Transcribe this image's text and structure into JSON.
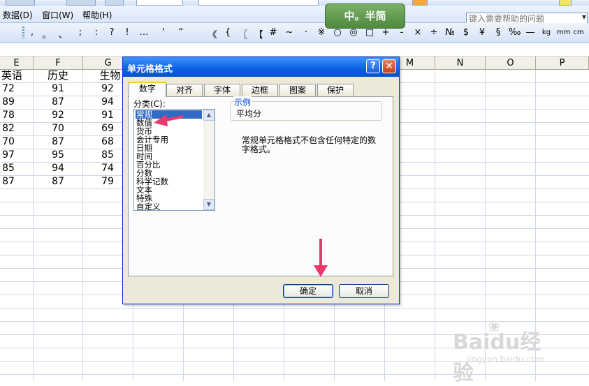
{
  "menu": {
    "items": [
      "数据(D)",
      "窗口(W)",
      "帮助(H)"
    ],
    "help_search_placeholder": "键入需要帮助的问题"
  },
  "badge": {
    "text": "中。半简"
  },
  "symbols": [
    ",",
    "。",
    "、",
    ";",
    ":",
    "?",
    "!",
    "…",
    "‘",
    "“",
    "《",
    "{",
    "〖",
    "【",
    "#",
    "~",
    "·",
    "※",
    "○",
    "◎",
    "□",
    "+",
    "-",
    "×",
    "÷",
    "№",
    "$",
    "¥",
    "§",
    "‰",
    "—",
    "kg",
    "mm",
    "cm"
  ],
  "spreadsheet": {
    "columns": [
      "E",
      "F",
      "G",
      "M",
      "N",
      "O",
      "P"
    ],
    "headers": [
      "英语",
      "历史",
      "生物"
    ],
    "rows": [
      [
        "72",
        "91",
        "92"
      ],
      [
        "89",
        "87",
        "94"
      ],
      [
        "78",
        "92",
        "91"
      ],
      [
        "82",
        "70",
        "69"
      ],
      [
        "70",
        "87",
        "68"
      ],
      [
        "97",
        "95",
        "85"
      ],
      [
        "85",
        "94",
        "74"
      ],
      [
        "87",
        "87",
        "79"
      ]
    ]
  },
  "dialog": {
    "title": "单元格格式",
    "help_button": "?",
    "close_button": "✕",
    "tabs": [
      "数字",
      "对齐",
      "字体",
      "边框",
      "图案",
      "保护"
    ],
    "active_tab": "数字",
    "category_label": "分类(C):",
    "categories": [
      "常规",
      "数值",
      "货币",
      "会计专用",
      "日期",
      "时间",
      "百分比",
      "分数",
      "科学记数",
      "文本",
      "特殊",
      "自定义"
    ],
    "selected_category": "常规",
    "sample_label": "示例",
    "sample_value": "平均分",
    "description": "常规单元格格式不包含任何特定的数字格式。",
    "ok_label": "确定",
    "cancel_label": "取消"
  },
  "watermark": {
    "logo": "Baidu经验",
    "url": "jingyan.baidu.com"
  },
  "colors": {
    "title_bar": "#0a5fe3",
    "dialog_bg": "#ece9d8",
    "selection": "#316ac5",
    "annotation_arrow": "#ea3a6b",
    "active_tab_accent": "#ffc83c"
  }
}
